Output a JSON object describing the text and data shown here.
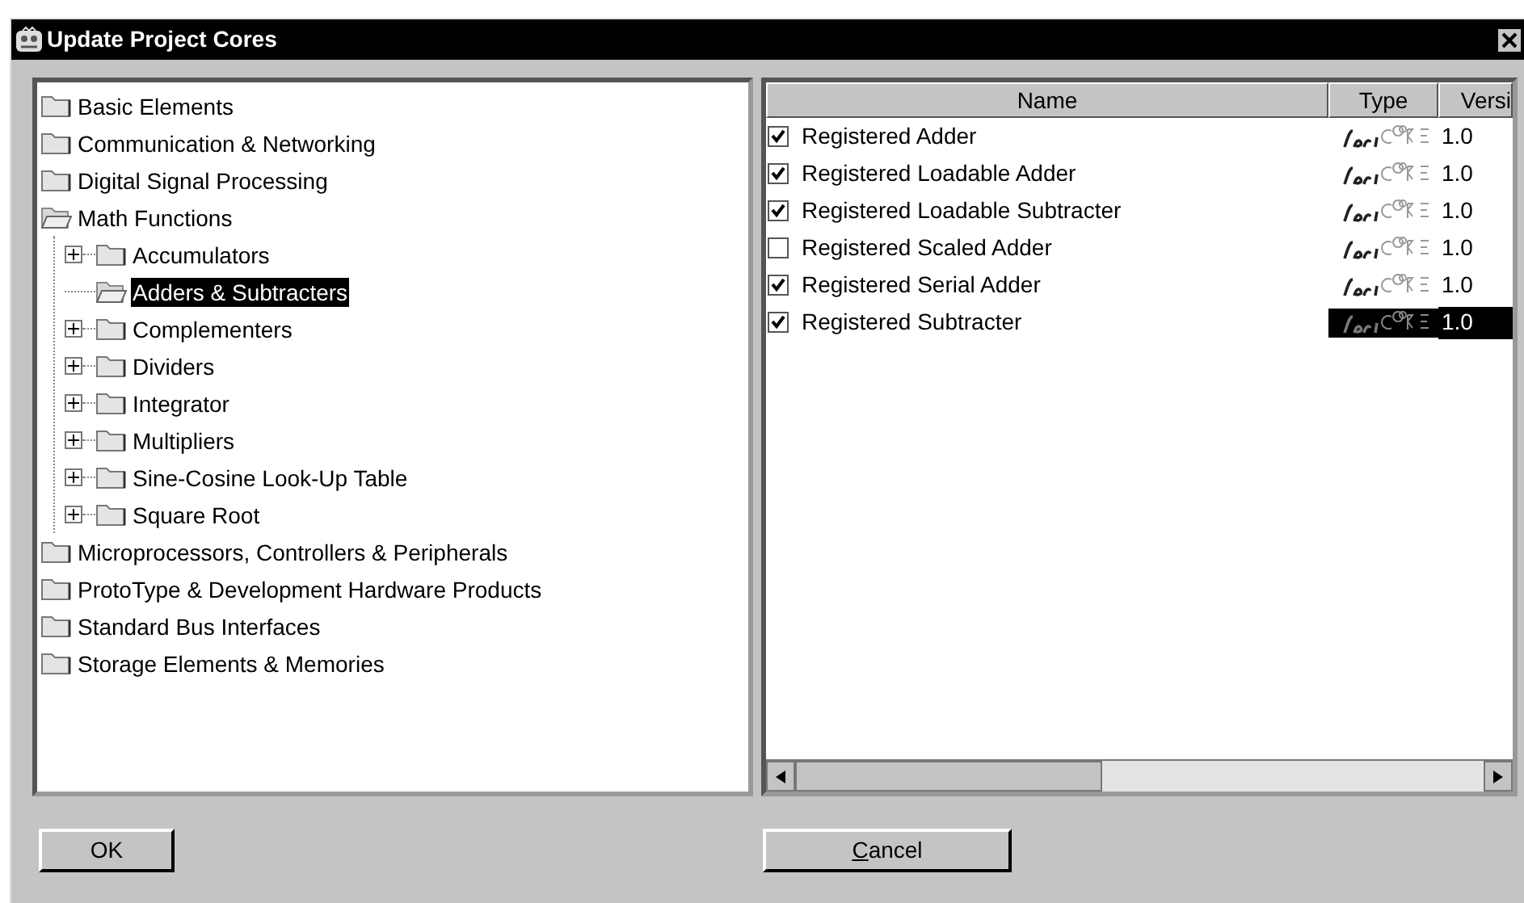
{
  "window": {
    "title": "Update Project Cores"
  },
  "tree": [
    {
      "label": "Basic Elements",
      "expanded": false,
      "selected": false
    },
    {
      "label": "Communication & Networking",
      "expanded": false,
      "selected": false
    },
    {
      "label": "Digital Signal Processing",
      "expanded": false,
      "selected": false
    },
    {
      "label": "Math Functions",
      "expanded": true,
      "selected": false,
      "children": [
        {
          "label": "Accumulators",
          "expandable": true,
          "expanded": false,
          "selected": false
        },
        {
          "label": "Adders & Subtracters",
          "expandable": false,
          "expanded": true,
          "selected": true
        },
        {
          "label": "Complementers",
          "expandable": true,
          "expanded": false,
          "selected": false
        },
        {
          "label": "Dividers",
          "expandable": true,
          "expanded": false,
          "selected": false
        },
        {
          "label": "Integrator",
          "expandable": true,
          "expanded": false,
          "selected": false
        },
        {
          "label": "Multipliers",
          "expandable": true,
          "expanded": false,
          "selected": false
        },
        {
          "label": "Sine-Cosine Look-Up Table",
          "expandable": true,
          "expanded": false,
          "selected": false
        },
        {
          "label": "Square Root",
          "expandable": true,
          "expanded": false,
          "selected": false
        }
      ]
    },
    {
      "label": "Microprocessors, Controllers & Peripherals",
      "expanded": false,
      "selected": false
    },
    {
      "label": "ProtoType & Development Hardware Products",
      "expanded": false,
      "selected": false
    },
    {
      "label": "Standard Bus Interfaces",
      "expanded": false,
      "selected": false
    },
    {
      "label": "Storage Elements & Memories",
      "expanded": false,
      "selected": false
    }
  ],
  "table": {
    "columns": [
      "Name",
      "Type",
      "Versi"
    ],
    "rows": [
      {
        "checked": true,
        "name": "Registered Adder",
        "version": "1.0",
        "selected": false
      },
      {
        "checked": true,
        "name": "Registered Loadable Adder",
        "version": "1.0",
        "selected": false
      },
      {
        "checked": true,
        "name": "Registered Loadable Subtracter",
        "version": "1.0",
        "selected": false
      },
      {
        "checked": false,
        "name": "Registered Scaled Adder",
        "version": "1.0",
        "selected": false
      },
      {
        "checked": true,
        "name": "Registered Serial Adder",
        "version": "1.0",
        "selected": false
      },
      {
        "checked": true,
        "name": "Registered Subtracter",
        "version": "1.0",
        "selected": true
      }
    ]
  },
  "buttons": [
    {
      "label": "OK",
      "underline_first": false
    },
    {
      "label": "Cancel",
      "underline_first": true
    }
  ]
}
